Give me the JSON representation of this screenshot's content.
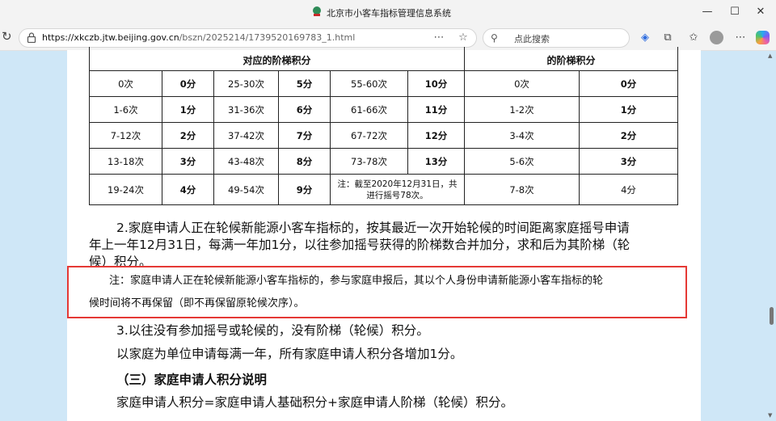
{
  "window": {
    "title": "北京市小客车指标管理信息系统",
    "min": "—",
    "max": "☐",
    "close": "✕"
  },
  "toolbar": {
    "url_host": "https://xkczb.jtw.beijing.gov.cn",
    "url_path": "/bszn/2025214/1739520169783_1.html",
    "search_placeholder": "点此搜索"
  },
  "table": {
    "header_left": "对应的阶梯积分",
    "header_right": "的阶梯积分",
    "rows": [
      [
        "0次",
        "0分",
        "25-30次",
        "5分",
        "55-60次",
        "10分",
        "0次",
        "0分"
      ],
      [
        "1-6次",
        "1分",
        "31-36次",
        "6分",
        "61-66次",
        "11分",
        "1-2次",
        "1分"
      ],
      [
        "7-12次",
        "2分",
        "37-42次",
        "7分",
        "67-72次",
        "12分",
        "3-4次",
        "2分"
      ],
      [
        "13-18次",
        "3分",
        "43-48次",
        "8分",
        "73-78次",
        "13分",
        "5-6次",
        "3分"
      ],
      [
        "19-24次",
        "4分",
        "49-54次",
        "9分",
        "",
        "",
        "7-8次",
        "4分"
      ]
    ],
    "note_line1": "注：截至2020年12月31日，共",
    "note_line2": "进行摇号78次。"
  },
  "content": {
    "para2_line1": "2.家庭申请人正在轮候新能源小客车指标的，按其最近一次开始轮候的时间距离家庭摇号申请",
    "para2_line2": "年上一年12月31日，每满一年加1分，以往参加摇号获得的阶梯数合并加分，求和后为其阶梯（轮",
    "para2_line3": "候）积分。",
    "note_line1": "注：家庭申请人正在轮候新能源小客车指标的，参与家庭申报后，其以个人身份申请新能源小客车指标的轮",
    "note_line2": "候时间将不再保留（即不再保留原轮候次序）。",
    "para3": "3.以往没有参加摇号或轮候的，没有阶梯（轮候）积分。",
    "para4": "以家庭为单位申请每满一年，所有家庭申请人积分各增加1分。",
    "section3": "（三）家庭申请人积分说明",
    "para5": "家庭申请人积分=家庭申请人基础积分+家庭申请人阶梯（轮候）积分。"
  }
}
